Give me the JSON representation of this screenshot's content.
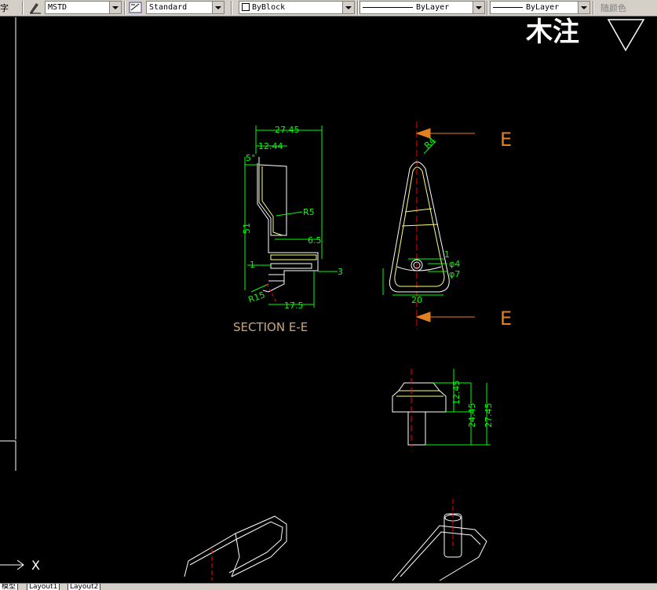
{
  "toolbar": {
    "left_partial_char": "字",
    "text_style": "MSTD",
    "dim_style": "Standard",
    "color": "ByBlock",
    "linetype": "ByLayer",
    "lineweight": "ByLayer",
    "plot_style": "随颜色"
  },
  "drawing": {
    "title_text": "木注",
    "section_label": "SECTION E-E",
    "section_marker_top": "E",
    "section_marker_bottom": "E",
    "left_view_dims": [
      "27.45",
      "12.44",
      "5°",
      "51",
      "R5",
      "6.5",
      "1",
      "3",
      "R15",
      "17.5"
    ],
    "front_view_dims": [
      "R4",
      "1",
      "φ4",
      "φ7",
      "20"
    ],
    "bottom_view_dims": [
      "12.45",
      "24.45",
      "27.45"
    ],
    "ucs_label": "X",
    "colors": {
      "dimension": "#00ff00",
      "geometry": "#ffffff",
      "profile": "#ffff80",
      "centerline": "#ff0000",
      "arrow": "#e08020",
      "section_text": "#c8a878"
    }
  },
  "tabs": {
    "model": "模型",
    "layout1": "Layout1",
    "layout2": "Layout2"
  }
}
